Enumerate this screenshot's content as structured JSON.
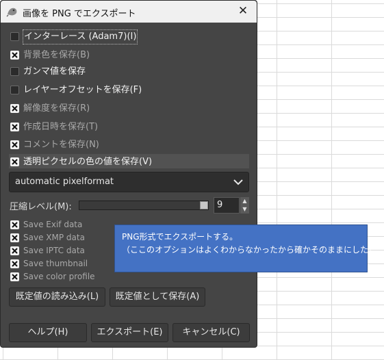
{
  "dialog": {
    "title": "画像を PNG でエクスポート",
    "close_glyph": "✕"
  },
  "options": [
    {
      "label": "インターレース (Adam7)(I)",
      "checked": false
    },
    {
      "label": "背景色を保存(B)",
      "checked": true
    },
    {
      "label": "ガンマ値を保存",
      "checked": false
    },
    {
      "label": "レイヤーオフセットを保存(F)",
      "checked": false
    },
    {
      "label": "解像度を保存(R)",
      "checked": true
    },
    {
      "label": "作成日時を保存(T)",
      "checked": true
    },
    {
      "label": "コメントを保存(N)",
      "checked": true
    },
    {
      "label": "透明ピクセルの色の値を保存(V)",
      "checked": true
    }
  ],
  "pixelformat": {
    "value": "automatic pixelformat"
  },
  "compression": {
    "label": "圧縮レベル(M):",
    "value": "9",
    "max": 9
  },
  "metadata": [
    {
      "label": "Save Exif data",
      "checked": true
    },
    {
      "label": "Save XMP data",
      "checked": true
    },
    {
      "label": "Save IPTC data",
      "checked": true
    },
    {
      "label": "Save thumbnail",
      "checked": true
    },
    {
      "label": "Save color profile",
      "checked": true
    }
  ],
  "buttons": {
    "load_defaults": "既定値の読み込み(L)",
    "save_defaults": "既定値として保存(A)",
    "help": "ヘルプ(H)",
    "export": "エクスポート(E)",
    "cancel": "キャンセル(C)"
  },
  "note": {
    "line1": "PNG形式でエクスポートする。",
    "line2": "（ここのオプションはよくわからなかったから確かそのままにした）"
  },
  "colors": {
    "note_bg": "#4472c4",
    "dialog_bg": "#454545"
  }
}
